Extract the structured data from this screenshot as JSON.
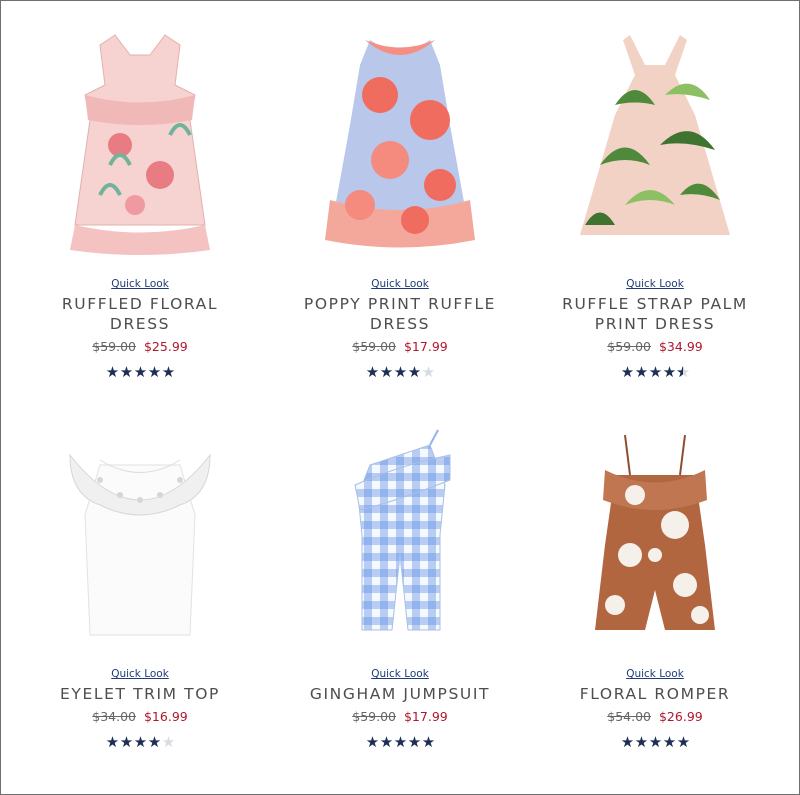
{
  "products": [
    {
      "quick_look": "Quick Look",
      "name_line1": "RUFFLED FLORAL",
      "name_line2": "DRESS",
      "was_price": "$59.00",
      "sale_price": "$25.99",
      "rating": 5,
      "image_icon": "ruffled-floral-dress-image",
      "colors": {
        "fabric": "#f6d3d0",
        "accent1": "#e87c82",
        "accent2": "#6fb39a"
      }
    },
    {
      "quick_look": "Quick Look",
      "name_line1": "POPPY PRINT RUFFLE",
      "name_line2": "DRESS",
      "was_price": "$59.00",
      "sale_price": "$17.99",
      "rating": 4,
      "image_icon": "poppy-print-dress-image",
      "colors": {
        "fabric": "#b9c8ea",
        "accent1": "#ef6c5f",
        "accent2": "#f7a08f"
      }
    },
    {
      "quick_look": "Quick Look",
      "name_line1": "RUFFLE STRAP PALM",
      "name_line2": "PRINT DRESS",
      "was_price": "$59.00",
      "sale_price": "$34.99",
      "rating": 4.5,
      "image_icon": "palm-print-dress-image",
      "colors": {
        "fabric": "#f3d2c6",
        "accent1": "#4f8a3c",
        "accent2": "#8cc063"
      }
    },
    {
      "quick_look": "Quick Look",
      "name_line1": "EYELET TRIM TOP",
      "name_line2": "",
      "was_price": "$34.00",
      "sale_price": "$16.99",
      "rating": 4,
      "image_icon": "eyelet-trim-top-image",
      "colors": {
        "fabric": "#fbfbfb",
        "accent1": "#e6e6e6",
        "accent2": "#d6d6d6"
      }
    },
    {
      "quick_look": "Quick Look",
      "name_line1": "GINGHAM JUMPSUIT",
      "name_line2": "",
      "was_price": "$59.00",
      "sale_price": "$17.99",
      "rating": 5,
      "image_icon": "gingham-jumpsuit-image",
      "colors": {
        "fabric": "#dbe6fb",
        "accent1": "#93b3ec",
        "accent2": "#b9cdf3"
      }
    },
    {
      "quick_look": "Quick Look",
      "name_line1": "FLORAL ROMPER",
      "name_line2": "",
      "was_price": "$54.00",
      "sale_price": "$26.99",
      "rating": 5,
      "image_icon": "floral-romper-image",
      "colors": {
        "fabric": "#b1663f",
        "accent1": "#f5f0ea",
        "accent2": "#8f4d2e"
      }
    }
  ],
  "colors": {
    "sale_red": "#b0172c",
    "star_navy": "#1c2f55",
    "link_blue": "#1f3c78"
  }
}
